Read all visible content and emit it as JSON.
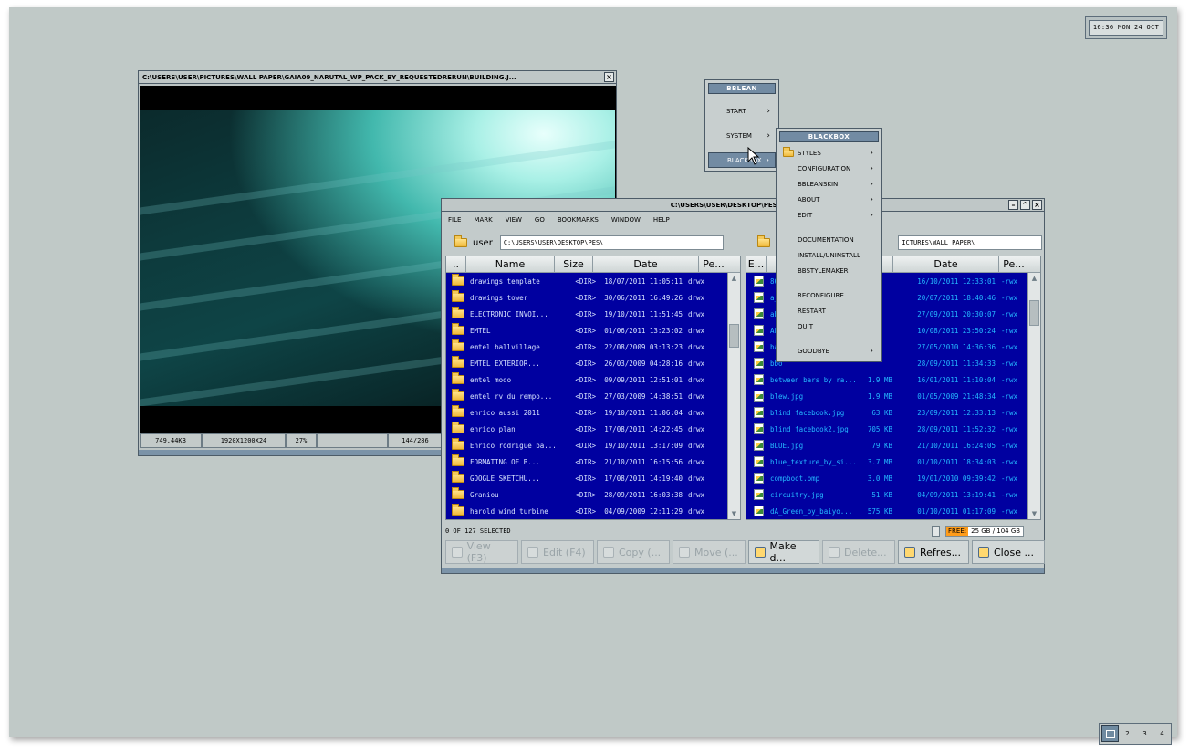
{
  "clock": {
    "text": "16:36 MON 24 OCT"
  },
  "workspaces": [
    "",
    "2",
    "3",
    "4"
  ],
  "viewer": {
    "title": "C:\\USERS\\USER\\PICTURES\\WALL PAPER\\GAIA09_NARUTAL_WP_PACK_BY_REQUESTEDRERUN\\BUILDING.J...",
    "close": "×",
    "status": [
      "749.44KB",
      "1920X1200X24",
      "27%",
      "",
      "144/286"
    ]
  },
  "fm": {
    "title": "C:\\USERS\\USER\\DESKTOP\\PES\\",
    "menu": [
      "FILE",
      "MARK",
      "VIEW",
      "GO",
      "BOOKMARKS",
      "WINDOW",
      "HELP"
    ],
    "left_folder": "user",
    "left_path": "C:\\USERS\\USER\\DESKTOP\\PES\\",
    "right_folder": "u",
    "right_path": "ICTURES\\WALL PAPER\\",
    "left_headers": [
      "..",
      "Name",
      "Size",
      "Date",
      "Pe..."
    ],
    "right_headers": [
      "E...",
      "",
      "Date",
      "Pe..."
    ],
    "left_rows": [
      {
        "name": "drawings template",
        "size": "<DIR>",
        "date": "18/07/2011 11:05:11",
        "perm": "drwx"
      },
      {
        "name": "drawings tower",
        "size": "<DIR>",
        "date": "30/06/2011 16:49:26",
        "perm": "drwx"
      },
      {
        "name": "ELECTRONIC INVOI...",
        "size": "<DIR>",
        "date": "19/10/2011 11:51:45",
        "perm": "drwx"
      },
      {
        "name": "EMTEL",
        "size": "<DIR>",
        "date": "01/06/2011 13:23:02",
        "perm": "drwx"
      },
      {
        "name": "emtel ballvillage",
        "size": "<DIR>",
        "date": "22/08/2009 03:13:23",
        "perm": "drwx"
      },
      {
        "name": "EMTEL EXTERIOR...",
        "size": "<DIR>",
        "date": "26/03/2009 04:28:16",
        "perm": "drwx"
      },
      {
        "name": "emtel modo",
        "size": "<DIR>",
        "date": "09/09/2011 12:51:01",
        "perm": "drwx"
      },
      {
        "name": "emtel rv du rempo...",
        "size": "<DIR>",
        "date": "27/03/2009 14:38:51",
        "perm": "drwx"
      },
      {
        "name": "enrico aussi 2011",
        "size": "<DIR>",
        "date": "19/10/2011 11:06:04",
        "perm": "drwx"
      },
      {
        "name": "enrico plan",
        "size": "<DIR>",
        "date": "17/08/2011 14:22:45",
        "perm": "drwx"
      },
      {
        "name": "Enrico rodrigue ba...",
        "size": "<DIR>",
        "date": "19/10/2011 13:17:09",
        "perm": "drwx"
      },
      {
        "name": "FORMATING OF B...",
        "size": "<DIR>",
        "date": "21/10/2011 16:15:56",
        "perm": "drwx"
      },
      {
        "name": "GOOGLE SKETCHU...",
        "size": "<DIR>",
        "date": "17/08/2011 14:19:40",
        "perm": "drwx"
      },
      {
        "name": "Graniou",
        "size": "<DIR>",
        "date": "28/09/2011 16:03:38",
        "perm": "drwx"
      },
      {
        "name": "harold wind turbine",
        "size": "<DIR>",
        "date": "04/09/2009 12:11:29",
        "perm": "drwx"
      }
    ],
    "right_rows": [
      {
        "name": "86",
        "size": "",
        "date": "16/10/2011 12:33:01",
        "perm": "-rwx"
      },
      {
        "name": "a_li",
        "size": "",
        "date": "20/07/2011 18:40:46",
        "perm": "-rwx"
      },
      {
        "name": "abs",
        "size": "",
        "date": "27/09/2011 20:30:07",
        "perm": "-rwx"
      },
      {
        "name": "AFN",
        "size": "",
        "date": "10/08/2011 23:50:24",
        "perm": "-rwx"
      },
      {
        "name": "ban",
        "size": "",
        "date": "27/05/2010 14:36:36",
        "perm": "-rwx"
      },
      {
        "name": "bbo",
        "size": "",
        "date": "28/09/2011 11:34:33",
        "perm": "-rwx"
      },
      {
        "name": "between bars by ra...",
        "size": "1.9 MB",
        "date": "16/01/2011 11:10:04",
        "perm": "-rwx"
      },
      {
        "name": "blew.jpg",
        "size": "1.9 MB",
        "date": "01/05/2009 21:48:34",
        "perm": "-rwx"
      },
      {
        "name": "blind facebook.jpg",
        "size": "63 KB",
        "date": "23/09/2011 12:33:13",
        "perm": "-rwx"
      },
      {
        "name": "blind facebook2.jpg",
        "size": "705 KB",
        "date": "28/09/2011 11:52:32",
        "perm": "-rwx"
      },
      {
        "name": "BLUE.jpg",
        "size": "79 KB",
        "date": "21/10/2011 16:24:05",
        "perm": "-rwx"
      },
      {
        "name": "blue_texture_by_si...",
        "size": "3.7 MB",
        "date": "01/10/2011 18:34:03",
        "perm": "-rwx"
      },
      {
        "name": "compboot.bmp",
        "size": "3.0 MB",
        "date": "19/01/2010 09:39:42",
        "perm": "-rwx"
      },
      {
        "name": "circuitry.jpg",
        "size": "51 KB",
        "date": "04/09/2011 13:19:41",
        "perm": "-rwx"
      },
      {
        "name": "dA_Green_by_baiyo...",
        "size": "575 KB",
        "date": "01/10/2011 01:17:09",
        "perm": "-rwx"
      }
    ],
    "selection": "0 OF 127 SELECTED",
    "free_label": "FREE:",
    "free_value": "25 GB / 104 GB",
    "toolbar": [
      {
        "label": "View (F3)",
        "enabled": false,
        "icon": "magnifier-icon"
      },
      {
        "label": "Edit (F4)",
        "enabled": false,
        "icon": "pencil-icon"
      },
      {
        "label": "Copy (...",
        "enabled": false,
        "icon": "copy-icon"
      },
      {
        "label": "Move (...",
        "enabled": false,
        "icon": "move-icon"
      },
      {
        "label": "Make d...",
        "enabled": true,
        "icon": "folder-icon"
      },
      {
        "label": "Delete...",
        "enabled": false,
        "icon": "delete-icon"
      },
      {
        "label": "Refres...",
        "enabled": true,
        "icon": "refresh-icon"
      },
      {
        "label": "Close ...",
        "enabled": true,
        "icon": "close-window-icon"
      }
    ]
  },
  "menu_bblean": {
    "title": "BBLEAN",
    "items": [
      "START",
      "SYSTEM",
      "BLACKBOX"
    ]
  },
  "menu_blackbox": {
    "title": "BLACKBOX",
    "groups": [
      [
        "STYLES",
        "CONFIGURATION",
        "BBLEANSKIN",
        "ABOUT",
        "EDIT"
      ],
      [
        "DOCUMENTATION",
        "INSTALL/UNINSTALL",
        "BBSTYLEMAKER"
      ],
      [
        "RECONFIGURE",
        "RESTART",
        "QUIT"
      ],
      [
        "GOODBYE"
      ]
    ],
    "submenu_items": [
      "STYLES",
      "CONFIGURATION",
      "BBLEANSKIN",
      "ABOUT",
      "EDIT",
      "GOODBYE"
    ]
  },
  "colors": {
    "desktop": "#c0c9c7",
    "list_bg": "#0000a0",
    "accent": "#728ba3"
  }
}
